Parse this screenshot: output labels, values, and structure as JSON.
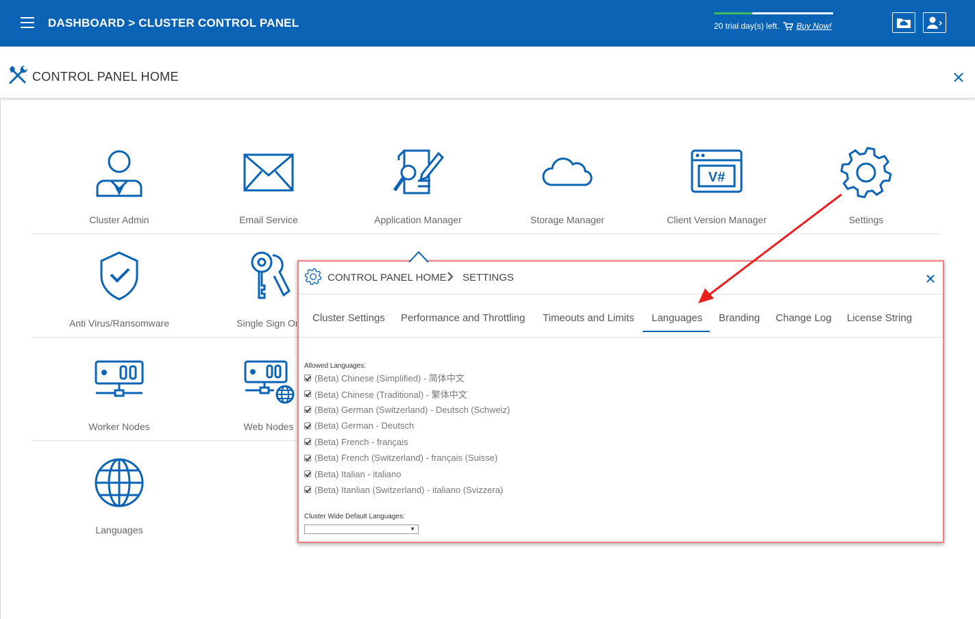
{
  "header": {
    "title": "DASHBOARD > CLUSTER CONTROL PANEL",
    "trial_text": "20 trial day(s) left.",
    "trial_progress": 0.32,
    "buy_label": "Buy Now!"
  },
  "subheader": {
    "title": "CONTROL PANEL HOME"
  },
  "tiles": [
    {
      "label": "Cluster Admin",
      "icon": "user-admin-icon"
    },
    {
      "label": "Email Service",
      "icon": "envelope-icon"
    },
    {
      "label": "Application Manager",
      "icon": "app-manager-icon"
    },
    {
      "label": "Storage Manager",
      "icon": "cloud-icon"
    },
    {
      "label": "Client Version Manager",
      "icon": "window-version-icon"
    },
    {
      "label": "Settings",
      "icon": "gear-icon"
    },
    {
      "label": "Anti Virus/Ransomware",
      "icon": "shield-check-icon"
    },
    {
      "label": "Single Sign On",
      "icon": "keys-icon"
    },
    {
      "label": "Worker Nodes",
      "icon": "server-icon"
    },
    {
      "label": "Web Nodes",
      "icon": "server-globe-icon"
    },
    {
      "label": "Languages",
      "icon": "globe-icon"
    }
  ],
  "popup": {
    "crumb_home": "CONTROL PANEL HOME",
    "crumb_current": "SETTINGS",
    "tabs": [
      {
        "label": "Cluster Settings"
      },
      {
        "label": "Performance and Throttling"
      },
      {
        "label": "Timeouts and Limits"
      },
      {
        "label": "Languages",
        "active": true
      },
      {
        "label": "Branding"
      },
      {
        "label": "Change Log"
      },
      {
        "label": "License String"
      }
    ],
    "allowed_label": "Allowed Languages:",
    "languages": [
      "(Beta) Chinese (Simplified) - 简体中文",
      "(Beta) Chinese (Traditional) - 繁体中文",
      "(Beta) German (Switzerland) - Deutsch (Schweiz)",
      "(Beta) German - Deutsch",
      "(Beta) French - français",
      "(Beta) French (Switzerland) - français (Suisse)",
      "(Beta) Italian - italiano",
      "(Beta) Itanlian (Switzerland) - italiano (Svizzera)"
    ],
    "default_label": "Cluster Wide Default Languages:",
    "default_value": ""
  },
  "colors": {
    "brand": "#0a63b5",
    "trial_fill": "#3dba5a",
    "popup_border": "#f08080",
    "annotation_arrow": "#e82020"
  }
}
